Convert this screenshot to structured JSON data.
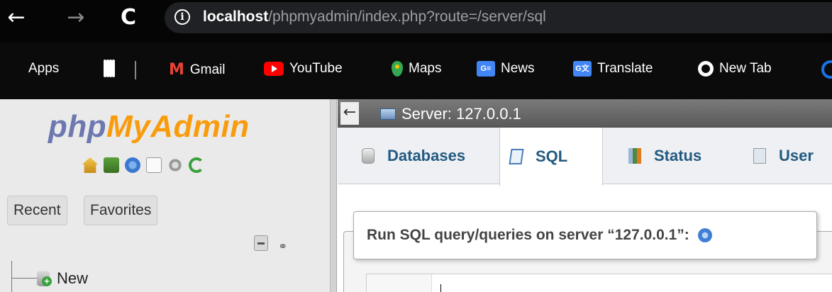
{
  "browser": {
    "url_host": "localhost",
    "url_path": "/phpmyadmin/index.php?route=/server/sql",
    "back_glyph": "←",
    "forward_glyph": "→",
    "reload_glyph": "C",
    "bookmarks": [
      {
        "label": "Apps",
        "icon": "apps-grid-icon"
      },
      {
        "label": "Gmail",
        "icon": "gmail-icon"
      },
      {
        "label": "YouTube",
        "icon": "youtube-icon"
      },
      {
        "label": "Maps",
        "icon": "maps-icon"
      },
      {
        "label": "News",
        "icon": "news-icon"
      },
      {
        "label": "Translate",
        "icon": "translate-icon"
      },
      {
        "label": "New Tab",
        "icon": "globe-icon"
      }
    ]
  },
  "sidebar": {
    "logo_php": "php",
    "logo_myadmin": "MyAdmin",
    "tabs": {
      "recent": "Recent",
      "favorites": "Favorites"
    },
    "tree": {
      "new_label": "New"
    }
  },
  "main": {
    "back_arrow": "←",
    "server_label": "Server: 127.0.0.1",
    "tabs": [
      {
        "label": "Databases"
      },
      {
        "label": "SQL"
      },
      {
        "label": "Status"
      },
      {
        "label": "User"
      }
    ],
    "active_tab": "SQL",
    "sql_legend": "Run SQL query/queries on server “127.0.0.1”:"
  },
  "colors": {
    "logo_php": "#6c78af",
    "logo_myadmin": "#f89c0e",
    "tab_text": "#235a81"
  }
}
